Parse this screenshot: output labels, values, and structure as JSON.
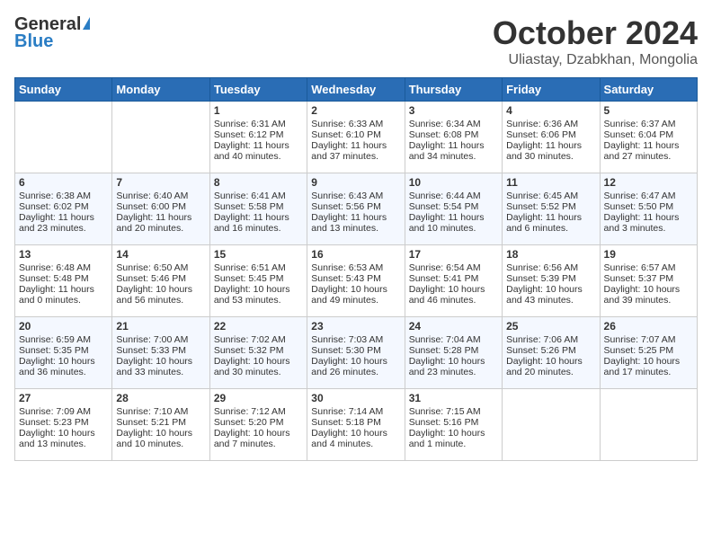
{
  "header": {
    "logo_general": "General",
    "logo_blue": "Blue",
    "month": "October 2024",
    "location": "Uliastay, Dzabkhan, Mongolia"
  },
  "days_of_week": [
    "Sunday",
    "Monday",
    "Tuesday",
    "Wednesday",
    "Thursday",
    "Friday",
    "Saturday"
  ],
  "weeks": [
    [
      {
        "day": "",
        "empty": true
      },
      {
        "day": "",
        "empty": true
      },
      {
        "day": "1",
        "sunrise": "Sunrise: 6:31 AM",
        "sunset": "Sunset: 6:12 PM",
        "daylight": "Daylight: 11 hours and 40 minutes."
      },
      {
        "day": "2",
        "sunrise": "Sunrise: 6:33 AM",
        "sunset": "Sunset: 6:10 PM",
        "daylight": "Daylight: 11 hours and 37 minutes."
      },
      {
        "day": "3",
        "sunrise": "Sunrise: 6:34 AM",
        "sunset": "Sunset: 6:08 PM",
        "daylight": "Daylight: 11 hours and 34 minutes."
      },
      {
        "day": "4",
        "sunrise": "Sunrise: 6:36 AM",
        "sunset": "Sunset: 6:06 PM",
        "daylight": "Daylight: 11 hours and 30 minutes."
      },
      {
        "day": "5",
        "sunrise": "Sunrise: 6:37 AM",
        "sunset": "Sunset: 6:04 PM",
        "daylight": "Daylight: 11 hours and 27 minutes."
      }
    ],
    [
      {
        "day": "6",
        "sunrise": "Sunrise: 6:38 AM",
        "sunset": "Sunset: 6:02 PM",
        "daylight": "Daylight: 11 hours and 23 minutes."
      },
      {
        "day": "7",
        "sunrise": "Sunrise: 6:40 AM",
        "sunset": "Sunset: 6:00 PM",
        "daylight": "Daylight: 11 hours and 20 minutes."
      },
      {
        "day": "8",
        "sunrise": "Sunrise: 6:41 AM",
        "sunset": "Sunset: 5:58 PM",
        "daylight": "Daylight: 11 hours and 16 minutes."
      },
      {
        "day": "9",
        "sunrise": "Sunrise: 6:43 AM",
        "sunset": "Sunset: 5:56 PM",
        "daylight": "Daylight: 11 hours and 13 minutes."
      },
      {
        "day": "10",
        "sunrise": "Sunrise: 6:44 AM",
        "sunset": "Sunset: 5:54 PM",
        "daylight": "Daylight: 11 hours and 10 minutes."
      },
      {
        "day": "11",
        "sunrise": "Sunrise: 6:45 AM",
        "sunset": "Sunset: 5:52 PM",
        "daylight": "Daylight: 11 hours and 6 minutes."
      },
      {
        "day": "12",
        "sunrise": "Sunrise: 6:47 AM",
        "sunset": "Sunset: 5:50 PM",
        "daylight": "Daylight: 11 hours and 3 minutes."
      }
    ],
    [
      {
        "day": "13",
        "sunrise": "Sunrise: 6:48 AM",
        "sunset": "Sunset: 5:48 PM",
        "daylight": "Daylight: 11 hours and 0 minutes."
      },
      {
        "day": "14",
        "sunrise": "Sunrise: 6:50 AM",
        "sunset": "Sunset: 5:46 PM",
        "daylight": "Daylight: 10 hours and 56 minutes."
      },
      {
        "day": "15",
        "sunrise": "Sunrise: 6:51 AM",
        "sunset": "Sunset: 5:45 PM",
        "daylight": "Daylight: 10 hours and 53 minutes."
      },
      {
        "day": "16",
        "sunrise": "Sunrise: 6:53 AM",
        "sunset": "Sunset: 5:43 PM",
        "daylight": "Daylight: 10 hours and 49 minutes."
      },
      {
        "day": "17",
        "sunrise": "Sunrise: 6:54 AM",
        "sunset": "Sunset: 5:41 PM",
        "daylight": "Daylight: 10 hours and 46 minutes."
      },
      {
        "day": "18",
        "sunrise": "Sunrise: 6:56 AM",
        "sunset": "Sunset: 5:39 PM",
        "daylight": "Daylight: 10 hours and 43 minutes."
      },
      {
        "day": "19",
        "sunrise": "Sunrise: 6:57 AM",
        "sunset": "Sunset: 5:37 PM",
        "daylight": "Daylight: 10 hours and 39 minutes."
      }
    ],
    [
      {
        "day": "20",
        "sunrise": "Sunrise: 6:59 AM",
        "sunset": "Sunset: 5:35 PM",
        "daylight": "Daylight: 10 hours and 36 minutes."
      },
      {
        "day": "21",
        "sunrise": "Sunrise: 7:00 AM",
        "sunset": "Sunset: 5:33 PM",
        "daylight": "Daylight: 10 hours and 33 minutes."
      },
      {
        "day": "22",
        "sunrise": "Sunrise: 7:02 AM",
        "sunset": "Sunset: 5:32 PM",
        "daylight": "Daylight: 10 hours and 30 minutes."
      },
      {
        "day": "23",
        "sunrise": "Sunrise: 7:03 AM",
        "sunset": "Sunset: 5:30 PM",
        "daylight": "Daylight: 10 hours and 26 minutes."
      },
      {
        "day": "24",
        "sunrise": "Sunrise: 7:04 AM",
        "sunset": "Sunset: 5:28 PM",
        "daylight": "Daylight: 10 hours and 23 minutes."
      },
      {
        "day": "25",
        "sunrise": "Sunrise: 7:06 AM",
        "sunset": "Sunset: 5:26 PM",
        "daylight": "Daylight: 10 hours and 20 minutes."
      },
      {
        "day": "26",
        "sunrise": "Sunrise: 7:07 AM",
        "sunset": "Sunset: 5:25 PM",
        "daylight": "Daylight: 10 hours and 17 minutes."
      }
    ],
    [
      {
        "day": "27",
        "sunrise": "Sunrise: 7:09 AM",
        "sunset": "Sunset: 5:23 PM",
        "daylight": "Daylight: 10 hours and 13 minutes."
      },
      {
        "day": "28",
        "sunrise": "Sunrise: 7:10 AM",
        "sunset": "Sunset: 5:21 PM",
        "daylight": "Daylight: 10 hours and 10 minutes."
      },
      {
        "day": "29",
        "sunrise": "Sunrise: 7:12 AM",
        "sunset": "Sunset: 5:20 PM",
        "daylight": "Daylight: 10 hours and 7 minutes."
      },
      {
        "day": "30",
        "sunrise": "Sunrise: 7:14 AM",
        "sunset": "Sunset: 5:18 PM",
        "daylight": "Daylight: 10 hours and 4 minutes."
      },
      {
        "day": "31",
        "sunrise": "Sunrise: 7:15 AM",
        "sunset": "Sunset: 5:16 PM",
        "daylight": "Daylight: 10 hours and 1 minute."
      },
      {
        "day": "",
        "empty": true
      },
      {
        "day": "",
        "empty": true
      }
    ]
  ]
}
